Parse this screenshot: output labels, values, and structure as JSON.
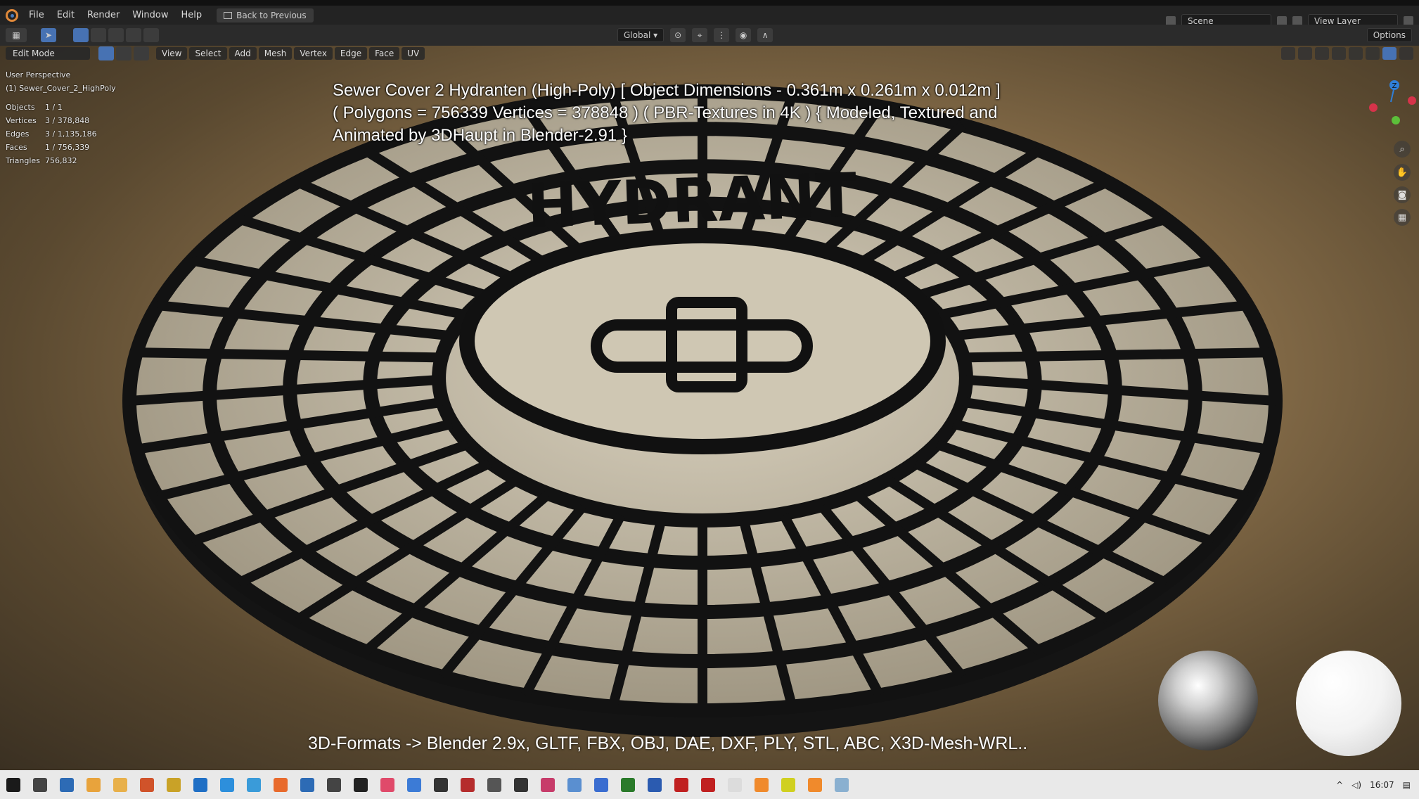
{
  "menubar": {
    "items": [
      "File",
      "Edit",
      "Render",
      "Window",
      "Help"
    ],
    "back_button": "Back to Previous",
    "scene": "Scene",
    "view_layer": "View Layer"
  },
  "toolbar": {
    "transform_orientation": "Global",
    "options": "Options"
  },
  "viewport_header": {
    "mode": "Edit Mode",
    "menus": [
      "View",
      "Select",
      "Add",
      "Mesh",
      "Vertex",
      "Edge",
      "Face",
      "UV"
    ]
  },
  "stats": {
    "view_name": "User Perspective",
    "object_name": "(1) Sewer_Cover_2_HighPoly",
    "rows": [
      {
        "label": "Objects",
        "value": "1 / 1"
      },
      {
        "label": "Vertices",
        "value": "3 / 378,848"
      },
      {
        "label": "Edges",
        "value": "3 / 1,135,186"
      },
      {
        "label": "Faces",
        "value": "1 / 756,339"
      },
      {
        "label": "Triangles",
        "value": "756,832"
      }
    ]
  },
  "overlay": {
    "title_line1": "Sewer Cover 2 Hydranten (High-Poly) [ Object Dimensions -  0.361m x 0.261m x 0.012m ]",
    "title_line2": "( Polygons = 756339 Vertices = 378848 ) ( PBR-Textures in 4K ) { Modeled, Textured and",
    "title_line3": "Animated by 3DHaupt in Blender-2.91 }",
    "formats": "3D-Formats -> Blender 2.9x, GLTF, FBX, OBJ, DAE, DXF, PLY, STL, ABC, X3D-Mesh-WRL..",
    "cover_text": "HYDRANT"
  },
  "gizmo": {
    "z_label": "Z"
  },
  "taskbar": {
    "time": "16:07",
    "icon_colors": [
      "#1a1a1a",
      "#444",
      "#2d6bb5",
      "#e8a33c",
      "#e8b04a",
      "#d0532a",
      "#c9a227",
      "#1f6fc5",
      "#2d8fdc",
      "#3a9bd9",
      "#e86a2c",
      "#2d6bb5",
      "#444",
      "#222",
      "#e04a6a",
      "#3c7bd6",
      "#333",
      "#b52d2d",
      "#555",
      "#333",
      "#c73c6a",
      "#5a8fd0",
      "#3a6dd0",
      "#2a7a2a",
      "#2b5bb0",
      "#c02020",
      "#c02020",
      "#dcdcdc",
      "#f08a2c",
      "#d0d020",
      "#f08a2c",
      "#8ab0d0"
    ]
  },
  "colors": {
    "accent": "#4772b3",
    "menubar_bg": "#232323",
    "viewport_bg": "#8f744e"
  }
}
